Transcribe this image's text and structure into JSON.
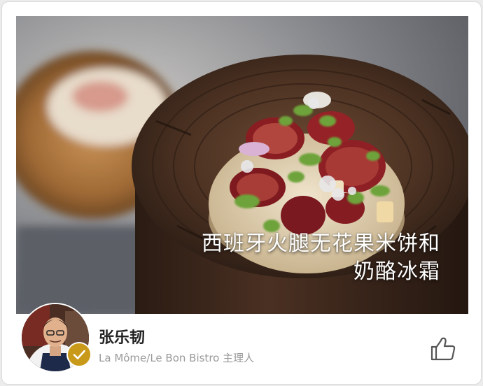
{
  "post": {
    "dish_title_line1": "西班牙火腿无花果米饼和",
    "dish_title_line2": "奶酪冰霜"
  },
  "author": {
    "name": "张乐韧",
    "role": "La Môme/Le Bon Bistro 主理人",
    "verified_icon": "check-badge-icon"
  },
  "actions": {
    "like_icon": "thumbs-up-icon"
  },
  "colors": {
    "badge": "#c99a1a",
    "name_text": "#222222",
    "role_text": "#9a9a9a"
  }
}
